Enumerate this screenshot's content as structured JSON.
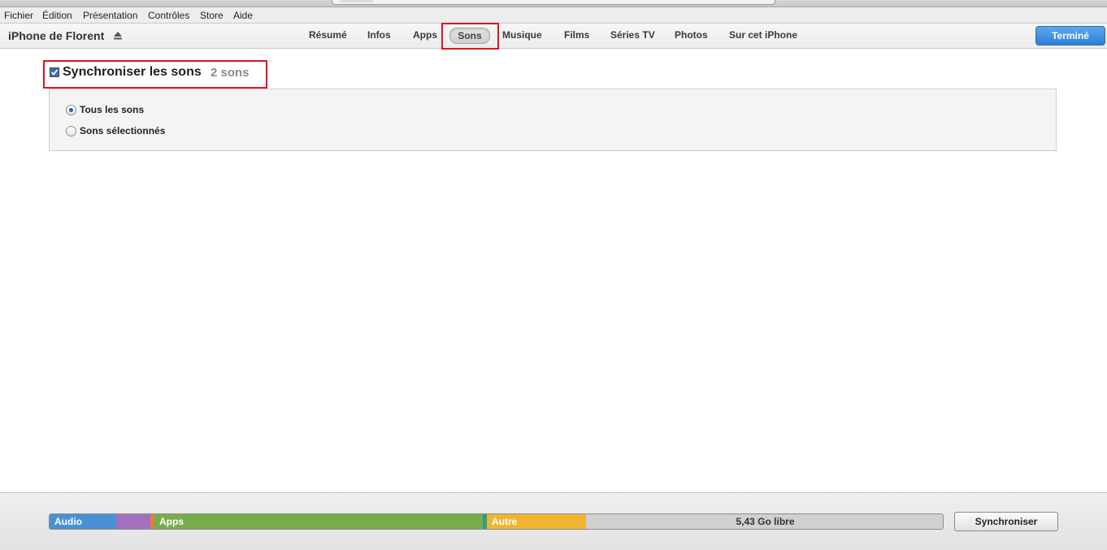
{
  "menu": [
    "Fichier",
    "Édition",
    "Présentation",
    "Contrôles",
    "Store",
    "Aide"
  ],
  "device": {
    "name": "iPhone de Florent"
  },
  "tabs": [
    "Résumé",
    "Infos",
    "Apps",
    "Sons",
    "Musique",
    "Films",
    "Séries TV",
    "Photos",
    "Sur cet iPhone"
  ],
  "active_tab": "Sons",
  "done_label": "Terminé",
  "sync": {
    "checked": true,
    "title": "Synchroniser les sons",
    "count": "2 sons"
  },
  "options": [
    {
      "label": "Tous les sons",
      "selected": true
    },
    {
      "label": "Sons sélectionnés",
      "selected": false
    }
  ],
  "capacity": {
    "segments": [
      {
        "name": "audio",
        "label": "Audio",
        "color": "#4a90d9"
      },
      {
        "name": "photos",
        "label": "",
        "color": "#a36fbe"
      },
      {
        "name": "books",
        "label": "",
        "color": "#e2803a"
      },
      {
        "name": "apps",
        "label": "Apps",
        "color": "#76ad4a"
      },
      {
        "name": "docs",
        "label": "",
        "color": "#2a9d8f"
      },
      {
        "name": "other",
        "label": "Autre",
        "color": "#f0b52f"
      },
      {
        "name": "free",
        "label": "5,43 Go libre",
        "color": "#d0d0d0"
      }
    ]
  },
  "sync_button": "Synchroniser",
  "colors": {
    "accent_blue": "#2f7fd9",
    "highlight_red": "#e0141e"
  }
}
